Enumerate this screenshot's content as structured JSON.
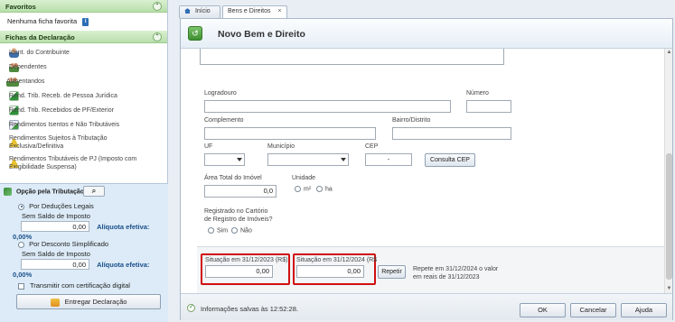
{
  "left_panel": {
    "favoritos_header": "Favoritos",
    "favoritos_empty": "Nenhuma ficha favorita",
    "fichas_header": "Fichas da Declaração",
    "fichas": [
      {
        "label": "Ident. do Contribuinte",
        "icon": "person-icon"
      },
      {
        "label": "Dependentes",
        "icon": "dependents-icon"
      },
      {
        "label": "Alimentandos",
        "icon": "people-icon"
      },
      {
        "label": "Rend. Trib. Receb. de Pessoa Jurídica",
        "icon": "arrow-doc-icon"
      },
      {
        "label": "Rend. Trib. Recebidos de PF/Exterior",
        "icon": "arrow-doc-icon"
      },
      {
        "label": "Rendimentos Isentos e Não Tributáveis",
        "icon": "doc-check-icon"
      },
      {
        "label": "Rendimentos Sujeitos à Tributação Exclusiva/Definitiva",
        "icon": "warning-icon"
      },
      {
        "label": "Rendimentos Tributáveis de PJ (Imposto com Exigibilidade Suspensa)",
        "icon": "warning-people-icon"
      }
    ]
  },
  "tributacao": {
    "header": "Opção pela Tributação:",
    "deducoes_label": "Por Deduções Legais",
    "deducoes_saldo_label": "Sem Saldo de Imposto",
    "deducoes_value": "0,00",
    "deducoes_aliquota": "Alíquota efetiva: 0,00%",
    "simplificado_label": "Por Desconto Simplificado",
    "simplificado_saldo_label": "Sem Saldo de Imposto",
    "simplificado_value": "0,00",
    "simplificado_aliquota": "Alíquota efetiva: 0,00%",
    "transmitir_label": "Transmitir com certificação digital",
    "entregar_label": "Entregar Declaração"
  },
  "tabs": [
    {
      "label": "Início"
    },
    {
      "label": "Bens e Direitos",
      "close": "×"
    }
  ],
  "main": {
    "title": "Novo Bem e Direito",
    "logradouro_label": "Logradouro",
    "numero_label": "Número",
    "complemento_label": "Complemento",
    "bairro_label": "Bairro/Distrito",
    "uf_label": "UF",
    "municipio_label": "Município",
    "cep_label": "CEP",
    "cep_value": "-",
    "consulta_cep_label": "Consulta CEP",
    "area_label": "Área Total do Imóvel",
    "area_value": "0,0",
    "unidade_label": "Unidade",
    "unidade_m2": "m²",
    "unidade_ha": "ha",
    "registrado_label_1": "Registrado no Cartório",
    "registrado_label_2": "de Registro de Imóveis?",
    "sim_label": "Sim",
    "nao_label": "Não",
    "situacao_2023_label": "Situação em 31/12/2023 (R$)",
    "situacao_2023_value": "0,00",
    "situacao_2024_label": "Situação em 31/12/2024 (R$",
    "situacao_2024_value": "0,00",
    "repetir_label": "Repetir",
    "repetir_hint_1": "Repete em 31/12/2024 o valor",
    "repetir_hint_2": "em reais de 31/12/2023"
  },
  "status": {
    "message": "Informações salvas às 12:52:28.",
    "ok_label": "OK",
    "cancelar_label": "Cancelar",
    "ajuda_label": "Ajuda"
  },
  "colors": {
    "highlight_red": "#d01010",
    "section_green": "#b9dfac",
    "panel_blue": "#dcebf7"
  }
}
